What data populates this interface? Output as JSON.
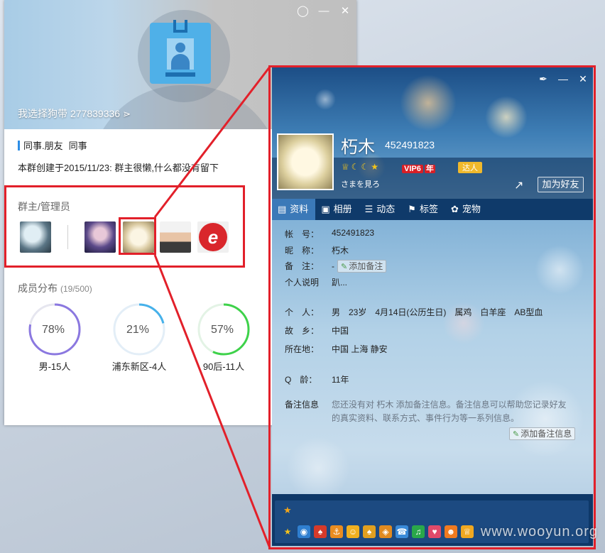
{
  "group": {
    "name": "我选择狗带",
    "number": "277839336",
    "tags": [
      "同事.朋友",
      "同事"
    ],
    "description": "本群创建于2015/11/23:  群主很懒,什么都没有留下",
    "admins_title": "群主/管理员",
    "members_title": "成员分布",
    "members_count": "(19/500)",
    "distribution": [
      {
        "percent": "78%",
        "value": 78,
        "label": "男-15人",
        "color": "#8b78e0"
      },
      {
        "percent": "21%",
        "value": 21,
        "label": "浦东新区-4人",
        "color": "#46b1ea"
      },
      {
        "percent": "57%",
        "value": 57,
        "label": "90后-11人",
        "color": "#3ed24a"
      }
    ]
  },
  "window_icons": {
    "skin": "skin-icon",
    "minimize": "minimize-icon",
    "close": "close-icon"
  },
  "profile": {
    "nickname": "朽木",
    "qq": "452491823",
    "vip_label": "VIP6",
    "vip_year": "年",
    "daren_label": "达人",
    "status": "さまを見ろ",
    "add_friend": "加为好友",
    "tabs": [
      "资料",
      "相册",
      "动态",
      "标签",
      "宠物"
    ],
    "fields": {
      "account_key": "帐　号：",
      "account_val": "452491823",
      "nick_key": "昵　称：",
      "nick_val": "朽木",
      "remark_key": "备　注：",
      "remark_val": "-",
      "add_remark": "添加备注",
      "sign_key": "个人说明",
      "sign_val": "趴...",
      "personal_key": "个　人：",
      "personal_val": "男　23岁　4月14日(公历生日)　属鸡　白羊座　AB型血",
      "hometown_key": "故　乡：",
      "hometown_val": "中国",
      "location_key": "所在地：",
      "location_val": "中国 上海 静安",
      "qage_key": "Q　龄：",
      "qage_val": "11年",
      "memo_key": "备注信息",
      "memo_val": "您还没有对 朽木 添加备注信息。备注信息可以帮助您记录好友的真实资料、联系方式、事件行为等一系列信息。",
      "add_memo": "添加备注信息"
    }
  },
  "watermark": "www.wooyun.org"
}
